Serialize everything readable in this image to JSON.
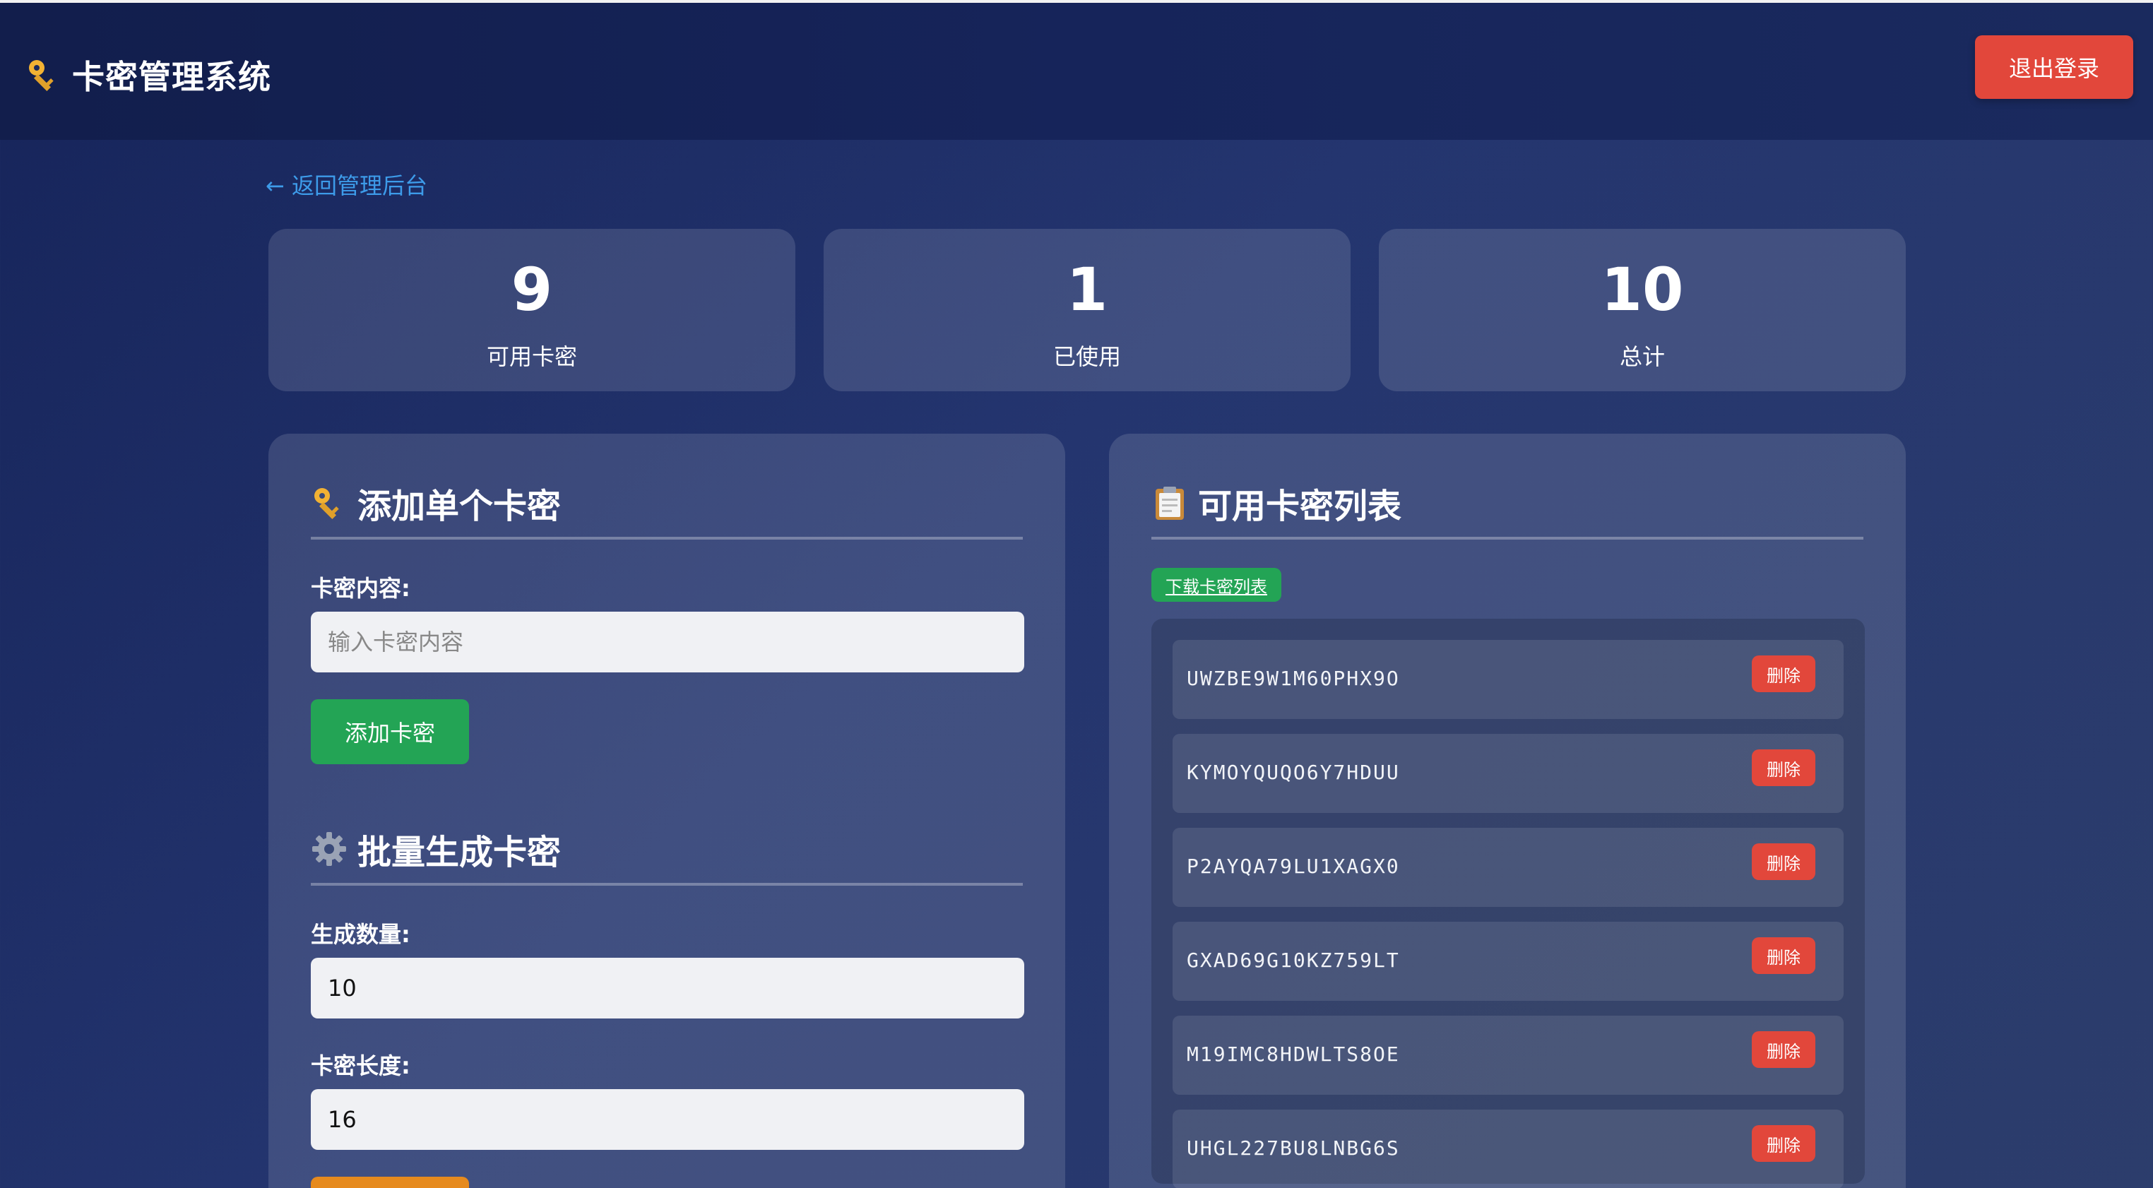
{
  "header": {
    "title": "卡密管理系统",
    "logout_label": "退出登录"
  },
  "nav": {
    "back_label": "← 返回管理后台"
  },
  "stats": [
    {
      "value": "9",
      "label": "可用卡密"
    },
    {
      "value": "1",
      "label": "已使用"
    },
    {
      "value": "10",
      "label": "总计"
    }
  ],
  "add_single": {
    "title": "添加单个卡密",
    "field_label": "卡密内容:",
    "placeholder": "输入卡密内容",
    "button_label": "添加卡密"
  },
  "batch": {
    "title": "批量生成卡密",
    "count_label": "生成数量:",
    "count_value": "10",
    "length_label": "卡密长度:",
    "length_value": "16"
  },
  "card_list": {
    "title": "可用卡密列表",
    "download_label": "下载卡密列表",
    "delete_label": "删除",
    "items": [
      "UWZBE9W1M60PHX9O",
      "KYMOYQUQO6Y7HDUU",
      "P2AYQA79LU1XAGX0",
      "GXAD69G10KZ759LT",
      "M19IMC8HDWLTS8OE",
      "UHGL227BU8LNBG6S"
    ]
  },
  "icons": {
    "key": "key-icon",
    "gear": "gear-icon",
    "clipboard": "clipboard-icon"
  },
  "colors": {
    "danger": "#e2473b",
    "success": "#23a455",
    "link": "#3d9be9",
    "warning": "#e68a1e"
  }
}
